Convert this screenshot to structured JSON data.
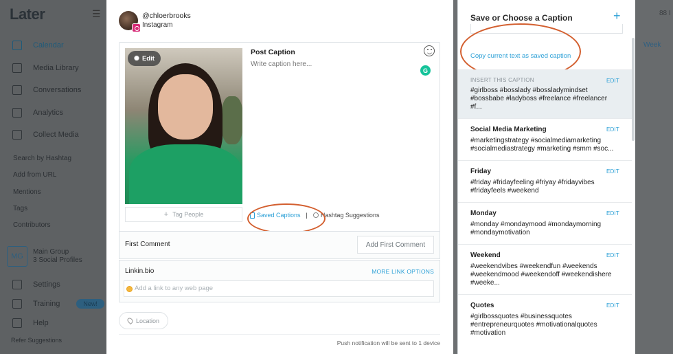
{
  "background": {
    "logo": "Later",
    "nav": [
      {
        "label": "Calendar",
        "active": true
      },
      {
        "label": "Media Library",
        "active": false
      },
      {
        "label": "Conversations",
        "active": false
      },
      {
        "label": "Analytics",
        "active": false
      },
      {
        "label": "Collect Media",
        "active": false
      }
    ],
    "sub_nav": [
      "Search by Hashtag",
      "Add from URL",
      "Mentions",
      "Tags",
      "Contributors"
    ],
    "group": {
      "initials": "MG",
      "name": "Main Group",
      "profiles": "3 Social Profiles"
    },
    "bottom_nav": [
      {
        "label": "Settings"
      },
      {
        "label": "Training",
        "badge": "New!"
      },
      {
        "label": "Help"
      }
    ],
    "refer": "Refer Suggestions",
    "right_tab": "Week",
    "right_top": "88 I"
  },
  "modal": {
    "account": {
      "handle": "@chloerbrooks",
      "network": "Instagram"
    },
    "photo_edit_label": "Edit",
    "tag_people": "Tag People",
    "caption": {
      "label": "Post Caption",
      "placeholder": "Write caption here..."
    },
    "saved_captions_label": "Saved Captions",
    "separator": "|",
    "hashtag_suggestions_label": "Hashtag Suggestions",
    "first_comment": {
      "label": "First Comment",
      "button": "Add First Comment"
    },
    "linkin_bio": {
      "label": "Linkin.bio",
      "more": "MORE LINK OPTIONS",
      "placeholder": "Add a link to any web page"
    },
    "location_label": "Location",
    "push_note": "Push notification will be sent to 1 device"
  },
  "panel": {
    "title": "Save or Choose a Caption",
    "add_symbol": "+",
    "copy_link": "Copy current text as saved caption",
    "edit_label": "EDIT",
    "captions": [
      {
        "name": "INSERT THIS CAPTION",
        "text": "#girlboss #bosslady #bossladymindset #bossbabe #ladyboss #freelance #freelancer #f...",
        "insert": true
      },
      {
        "name": "Social Media Marketing",
        "text": "#marketingstrategy #socialmediamarketing #socialmediastrategy #marketing #smm #soc..."
      },
      {
        "name": "Friday",
        "text": "#friday #fridayfeeling #friyay #fridayvibes #fridayfeels #weekend"
      },
      {
        "name": "Monday",
        "text": "#monday #mondaymood #mondaymorning #mondaymotivation"
      },
      {
        "name": "Weekend",
        "text": "#weekendvibes #weekendfun #weekends #weekendmood #weekendoff #weekendishere #weeke..."
      },
      {
        "name": "Quotes",
        "text": "#girlbossquotes #businessquotes #entrepreneurquotes #motivationalquotes #motivation"
      }
    ]
  },
  "colors": {
    "accent": "#2a9fd6",
    "annotation": "#d35f2f",
    "grammarly": "#15c39a",
    "instagram": "#d62976"
  }
}
